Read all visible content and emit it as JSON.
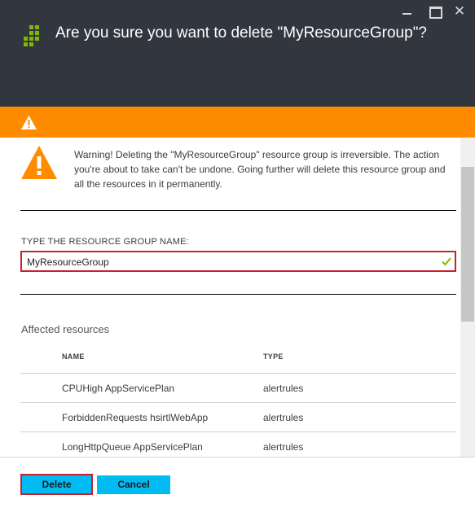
{
  "header": {
    "title": "Are you sure you want to delete \"MyResourceGroup\"?",
    "close_glyph": "✕"
  },
  "warning": {
    "message": "Warning! Deleting the \"MyResourceGroup\" resource group is irreversible. The action you're about to take can't be undone. Going further will delete this resource group and all the resources in it permanently."
  },
  "form": {
    "label": "TYPE THE RESOURCE GROUP NAME:",
    "value": "MyResourceGroup"
  },
  "affected": {
    "title": "Affected resources",
    "columns": [
      "NAME",
      "TYPE"
    ],
    "rows": [
      {
        "name": "CPUHigh AppServicePlan",
        "type": "alertrules"
      },
      {
        "name": "ForbiddenRequests hsirtlWebApp",
        "type": "alertrules"
      },
      {
        "name": "LongHttpQueue AppServicePlan",
        "type": "alertrules"
      }
    ]
  },
  "buttons": {
    "delete": "Delete",
    "cancel": "Cancel"
  },
  "colors": {
    "header_bg": "#32363f",
    "warning_orange": "#ff8c00",
    "button_blue": "#00bcf2",
    "error_red": "#c8202f",
    "check_green": "#7fba00"
  },
  "icons": {
    "window_minimize": "minimize-icon",
    "window_maximize": "maximize-icon",
    "window_close": "close-icon",
    "resource_group": "resource-group-icon",
    "warning": "warning-icon",
    "valid": "checkmark-icon"
  }
}
